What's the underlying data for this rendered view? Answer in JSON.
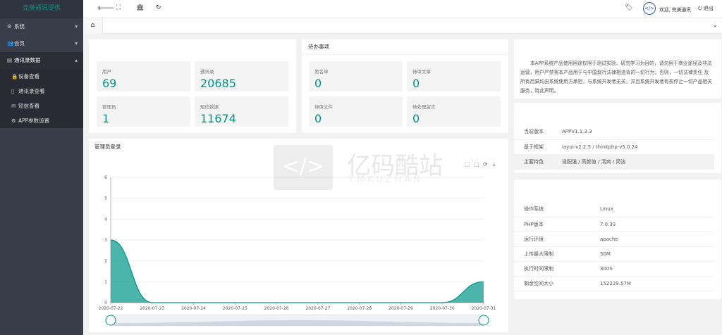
{
  "sidebar": {
    "logo": "完美通讯提供",
    "items": [
      {
        "label": "系统",
        "icon": "gear-icon"
      },
      {
        "label": "会员",
        "icon": "users-icon"
      },
      {
        "label": "通讯录数据",
        "icon": "address-card-icon"
      }
    ],
    "subitems": [
      {
        "label": "设备查看",
        "icon": "lock-icon"
      },
      {
        "label": "通讯录查看",
        "icon": "book-icon"
      },
      {
        "label": "短信查看",
        "icon": "mail-icon"
      },
      {
        "label": "APP参数设置",
        "icon": "gear-icon"
      }
    ]
  },
  "topbar": {
    "welcome": "欢迎, 完美通讯",
    "logout": "退出"
  },
  "stats_left": [
    {
      "label": "用户",
      "value": "69"
    },
    {
      "label": "通讯录",
      "value": "20685"
    },
    {
      "label": "管理员",
      "value": "1"
    },
    {
      "label": "短信数据",
      "value": "11674"
    }
  ],
  "todo": {
    "title": "待办事项",
    "items": [
      {
        "label": "黑名单",
        "value": "0"
      },
      {
        "label": "待审文章",
        "value": "0"
      },
      {
        "label": "待审文件",
        "value": "0"
      },
      {
        "label": "待处理留言",
        "value": "0"
      }
    ]
  },
  "notice": "本APP系统产品使用用途仅限于测试实验、研究学习为目的，请勿用于商业途径及非法运营，用户严禁将本产品用于与中国现行法律相违背的一切行为；否则，一切法律责任 及 所有后果均由系统使用方承担，与系统开发者无关，并且系统开发者有权停止一切产品相关服务，特此声明。",
  "version_info": [
    {
      "key": "当前版本",
      "value": "APPV1.1.3.3"
    },
    {
      "key": "基于框架",
      "value": "layui-v2.2.5 / thinkphp-v5.0.24"
    },
    {
      "key": "主要特色",
      "value": "适配强 / 高颜值 / 清爽 / 简洁"
    }
  ],
  "server_info": [
    {
      "key": "操作系统",
      "value": "Linux"
    },
    {
      "key": "PHP版本",
      "value": "7.0.33"
    },
    {
      "key": "运行环境",
      "value": "apache"
    },
    {
      "key": "上传最大限制",
      "value": "50M"
    },
    {
      "key": "执行时间限制",
      "value": "300S"
    },
    {
      "key": "剩余空间大小",
      "value": "152229.57M"
    }
  ],
  "watermark": {
    "main": "亿码酷站",
    "sub": "YMKUZHAN"
  },
  "colors": {
    "accent": "#009688",
    "sidebar": "#393d49"
  },
  "chart_data": {
    "type": "area",
    "title": "管理员登录",
    "categories": [
      "2020-07-22",
      "2020-07-23",
      "2020-07-24",
      "2020-07-25",
      "2020-07-26",
      "2020-07-27",
      "2020-07-28",
      "2020-07-29",
      "2020-07-30",
      "2020-07-31"
    ],
    "values": [
      3,
      0,
      0,
      0,
      0,
      0,
      0,
      0,
      0,
      1
    ],
    "yticks": [
      "0",
      "1",
      "2",
      "3",
      "4",
      "5",
      "6"
    ],
    "ylim": [
      0,
      6
    ],
    "grid": true,
    "smooth": true
  }
}
